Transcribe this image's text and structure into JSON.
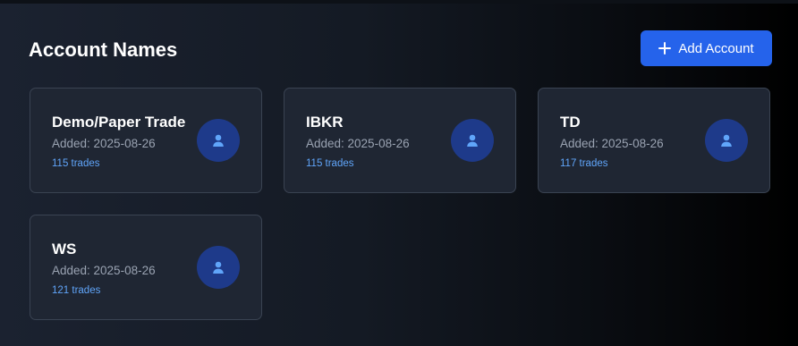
{
  "header": {
    "title": "Account Names",
    "add_button_label": "Add Account",
    "add_button_icon": "plus-icon"
  },
  "colors": {
    "accent": "#2563eb",
    "trades_text": "#60a5fa",
    "avatar_bg": "#1e3a8a",
    "card_bg": "#1f2633"
  },
  "accounts": [
    {
      "name": "Demo/Paper Trade",
      "added": "Added: 2025-08-26",
      "trades": "115 trades",
      "icon": "user-icon"
    },
    {
      "name": "IBKR",
      "added": "Added: 2025-08-26",
      "trades": "115 trades",
      "icon": "user-icon"
    },
    {
      "name": "TD",
      "added": "Added: 2025-08-26",
      "trades": "117 trades",
      "icon": "user-icon"
    },
    {
      "name": "WS",
      "added": "Added: 2025-08-26",
      "trades": "121 trades",
      "icon": "user-icon"
    }
  ]
}
